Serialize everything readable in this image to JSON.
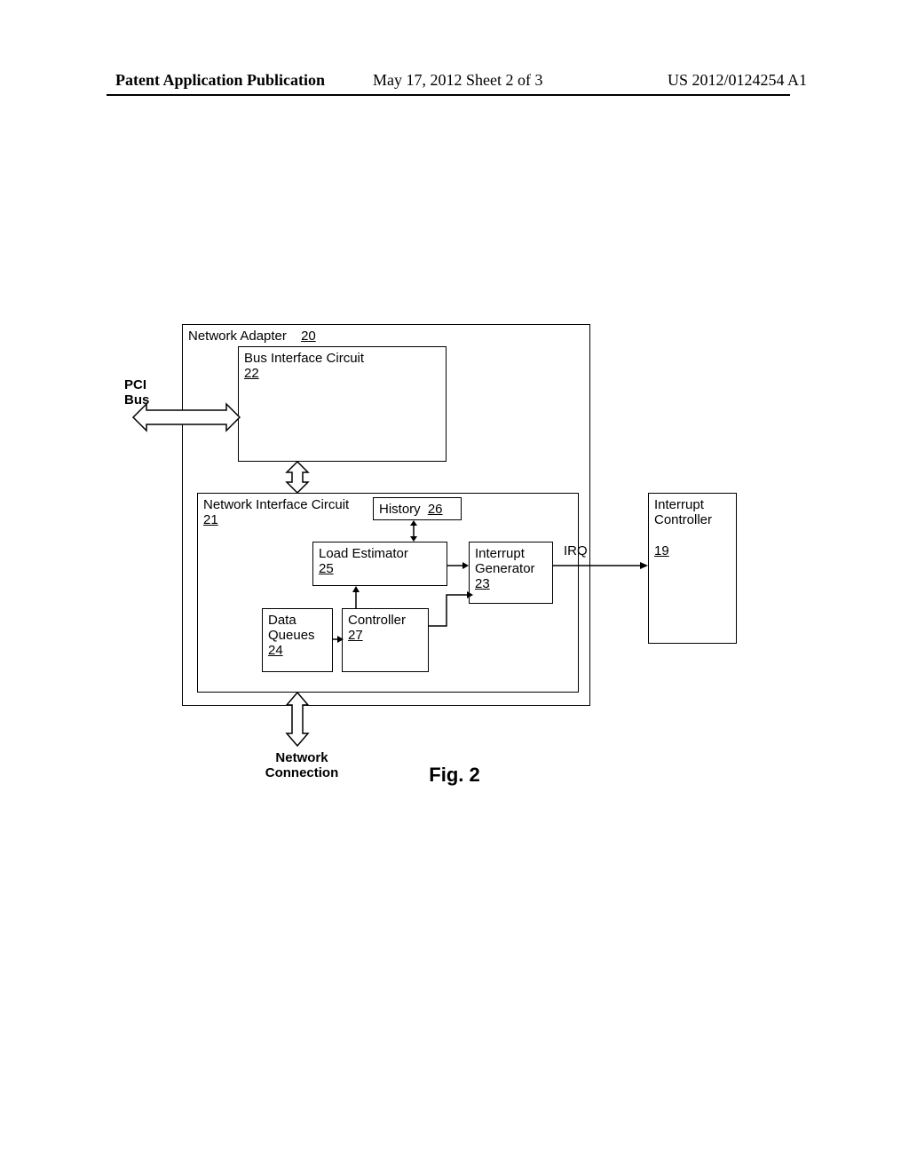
{
  "header": {
    "left": "Patent Application Publication",
    "center": "May 17, 2012  Sheet 2 of 3",
    "right": "US 2012/0124254 A1"
  },
  "labels": {
    "pci": "PCI",
    "bus": "Bus",
    "network_adapter": "Network Adapter",
    "na_ref": "20",
    "bus_iface": "Bus Interface Circuit",
    "bus_iface_ref": "22",
    "net_iface": "Network Interface Circuit",
    "net_iface_ref": "21",
    "history": "History",
    "history_ref": "26",
    "load_est": "Load Estimator",
    "load_est_ref": "25",
    "int_gen": "Interrupt",
    "int_gen2": "Generator",
    "int_gen_ref": "23",
    "data_queues": "Data",
    "data_queues2": "Queues",
    "data_queues_ref": "24",
    "controller": "Controller",
    "controller_ref": "27",
    "irq": "IRQ",
    "int_ctrl": "Interrupt",
    "int_ctrl2": "Controller",
    "int_ctrl_ref": "19",
    "net_conn": "Network",
    "net_conn2": "Connection"
  },
  "figure": "Fig. 2"
}
